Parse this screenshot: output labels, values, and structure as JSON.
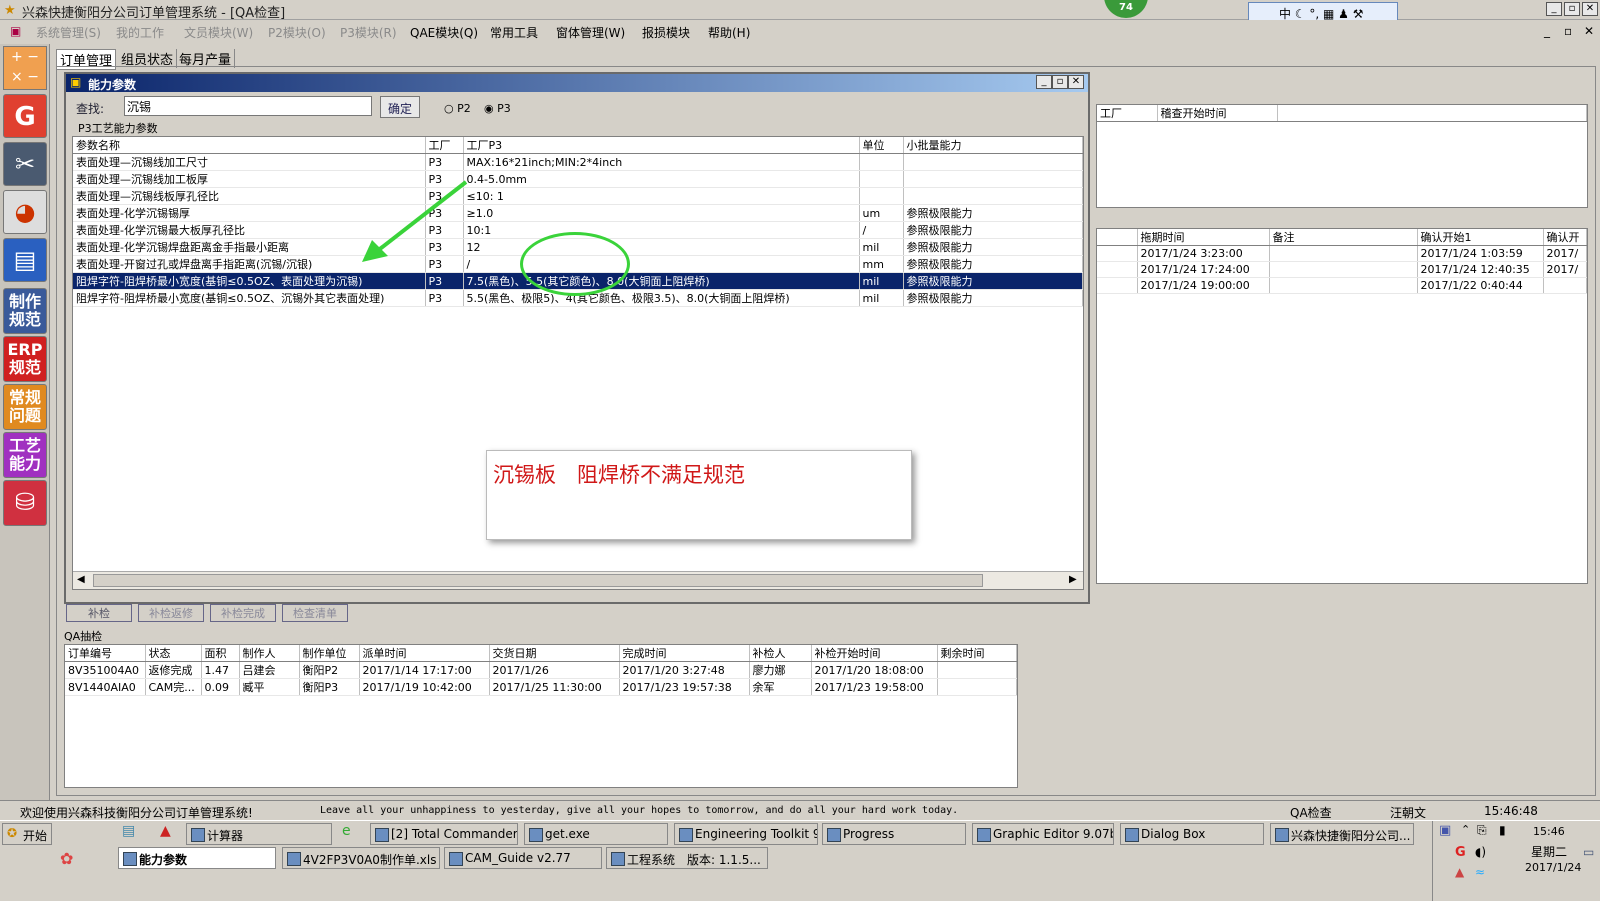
{
  "app": {
    "title": "兴森快捷衡阳分公司订单管理系统 - [QA检查]",
    "badge": "74"
  },
  "menu": {
    "items": [
      "系统管理(S)",
      "我的工作",
      "文员模块(W)",
      "P2模块(O)",
      "P3模块(R)",
      "QAE模块(Q)",
      "常用工具",
      "窗体管理(W)",
      "报损模块",
      "帮助(H)"
    ]
  },
  "ime": {
    "label": "中"
  },
  "tabs": [
    "订单管理",
    "组员状态",
    "每月产量"
  ],
  "sidebar": {
    "items": [
      "制作\n规范",
      "ERP\n规范",
      "常规\n问题",
      "工艺\n能力"
    ]
  },
  "dialog": {
    "title": "能力参数",
    "search_label": "查找:",
    "search_value": "沉锡",
    "confirm_label": "确定",
    "radio_p2": "P2",
    "radio_p3": "P3",
    "group_label": "P3工艺能力参数",
    "columns": [
      "参数名称",
      "工厂",
      "工厂P3",
      "单位",
      "小批量能力"
    ],
    "rows": [
      [
        "表面处理—沉锡线加工尺寸",
        "P3",
        "MAX:16*21inch;MIN:2*4inch",
        "",
        ""
      ],
      [
        "表面处理—沉锡线加工板厚",
        "P3",
        "0.4-5.0mm",
        "",
        ""
      ],
      [
        "表面处理—沉锡线板厚孔径比",
        "P3",
        "≤10: 1",
        "",
        ""
      ],
      [
        "表面处理-化学沉锡锡厚",
        "P3",
        "≥1.0",
        "um",
        "参照极限能力"
      ],
      [
        "表面处理-化学沉锡最大板厚孔径比",
        "P3",
        "10:1",
        "/",
        "参照极限能力"
      ],
      [
        "表面处理-化学沉锡焊盘距离金手指最小距离",
        "P3",
        "12",
        "mil",
        "参照极限能力"
      ],
      [
        "表面处理-开窗过孔或焊盘离手指距离(沉锡/沉银)",
        "P3",
        "/",
        "mm",
        "参照极限能力"
      ],
      [
        "阻焊字符-阻焊桥最小宽度(基铜≤0.5OZ、表面处理为沉锡)",
        "P3",
        "7.5(黑色)、5.5(其它颜色)、8.0(大铜面上阻焊桥)",
        "mil",
        "参照极限能力"
      ],
      [
        "阻焊字符-阻焊桥最小宽度(基铜≤0.5OZ、沉锡外其它表面处理)",
        "P3",
        "5.5(黑色、极限5)、4(其它颜色、极限3.5)、8.0(大铜面上阻焊桥)",
        "mil",
        "参照极限能力"
      ]
    ],
    "annotation": "沉锡板　阻焊桥不满足规范"
  },
  "right_panel": {
    "top_columns": [
      "工厂",
      "稽查开始时间"
    ],
    "bottom_columns": [
      "拖期时间",
      "备注",
      "确认开始1",
      "确认开"
    ],
    "rows": [
      [
        "2017/1/24 3:23:00",
        "",
        "2017/1/24 1:03:59",
        "2017/"
      ],
      [
        "2017/1/24 17:24:00",
        "",
        "2017/1/24 12:40:35",
        "2017/"
      ],
      [
        "2017/1/24 19:00:00",
        "",
        "2017/1/22 0:40:44",
        ""
      ]
    ]
  },
  "buttons": [
    "补检",
    "补检返修",
    "补检完成",
    "检查清单"
  ],
  "qa": {
    "label": "QA抽检",
    "columns": [
      "订单编号",
      "状态",
      "面积",
      "制作人",
      "制作单位",
      "派单时间",
      "交货日期",
      "完成时间",
      "补检人",
      "补检开始时间",
      "剩余时间"
    ],
    "rows": [
      [
        "8V351004A0",
        "返修完成",
        "1.47",
        "吕建会",
        "衡阳P2",
        "2017/1/14 17:17:00",
        "2017/1/26",
        "2017/1/20 3:27:48",
        "廖力娜",
        "2017/1/20 18:08:00",
        ""
      ],
      [
        "8V1440AIA0",
        "CAM完...",
        "0.09",
        "臧平",
        "衡阳P3",
        "2017/1/19 10:42:00",
        "2017/1/25 11:30:00",
        "2017/1/23 19:57:38",
        "余军",
        "2017/1/23 19:58:00",
        ""
      ]
    ]
  },
  "status": {
    "welcome": "欢迎使用兴森科技衡阳分公司订单管理系统!",
    "motto": "Leave all your unhappiness to yesterday, give all your hopes to tomorrow, and do all your hard work today.",
    "module": "QA检查",
    "user": "汪朝文",
    "time": "15:46:48"
  },
  "taskbar": {
    "start": "开始",
    "row1": [
      "计算器",
      "[2] Total Commander ...",
      "get.exe",
      "Engineering Toolkit 9....",
      "Progress",
      "Graphic Editor 9.07b2 ...",
      "Dialog Box",
      "兴森快捷衡阳分公司..."
    ],
    "row2": [
      "能力参数",
      "4V2FP3V0A0制作单.xls ...",
      "CAM_Guide v2.77",
      "工程系统　版本: 1.1.5..."
    ],
    "clock_time": "15:46",
    "clock_day": "星期二",
    "clock_date": "2017/1/24"
  }
}
